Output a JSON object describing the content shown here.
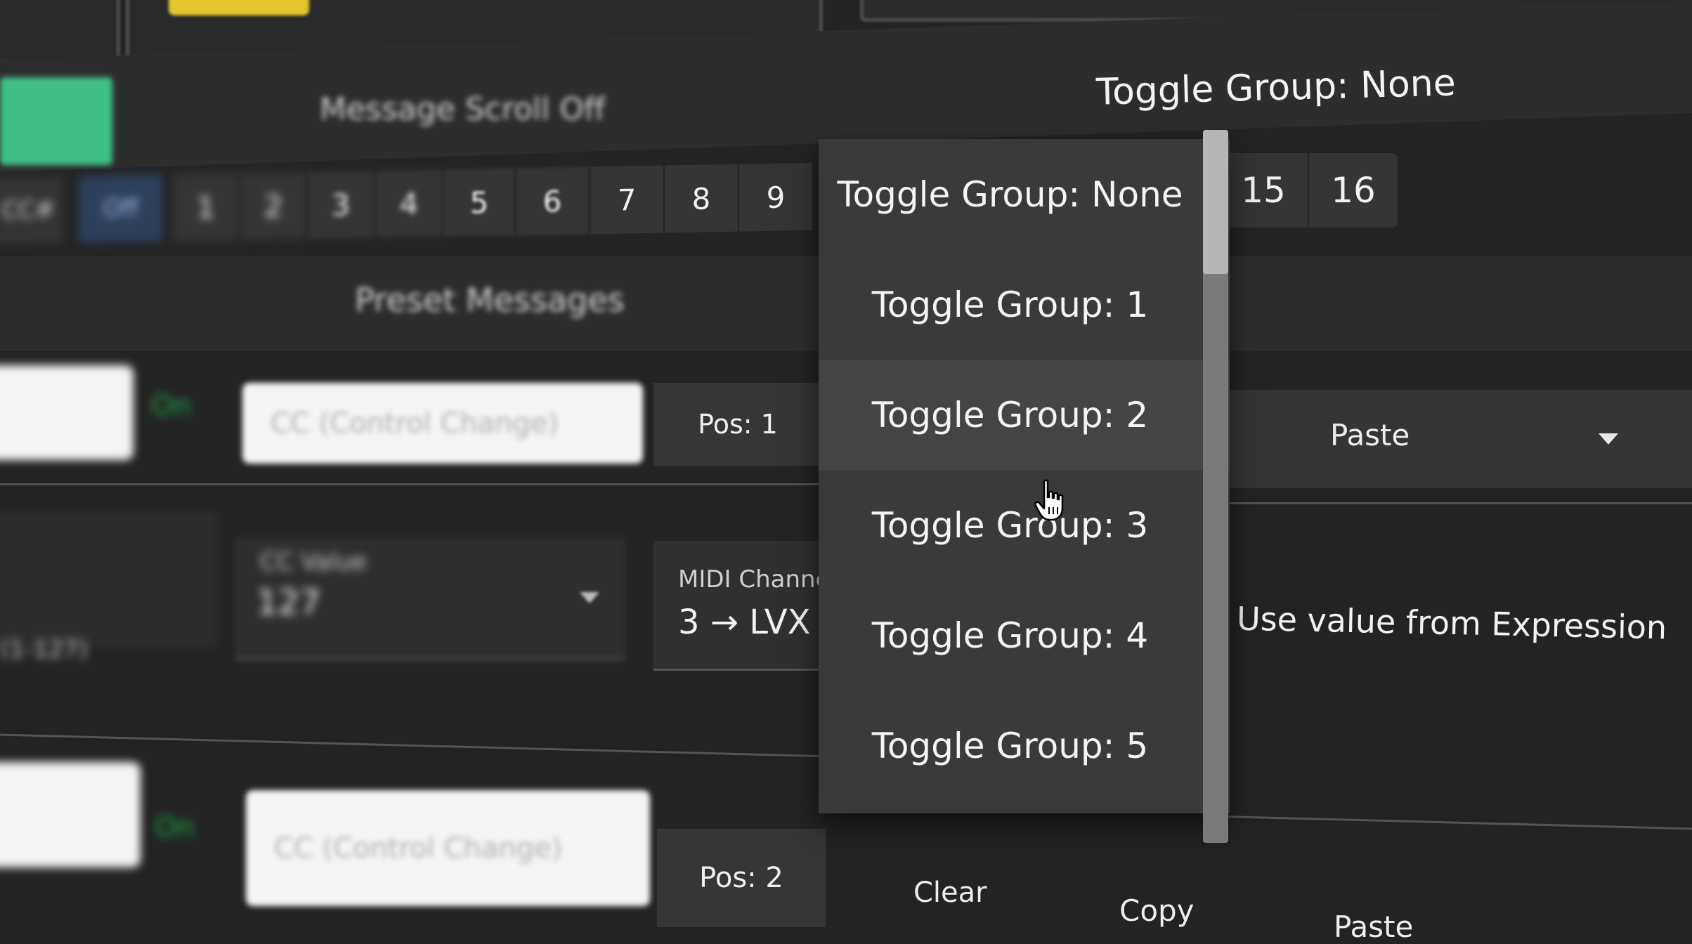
{
  "top": {
    "message_scroll": "Message Scroll Off",
    "toggle_group_current": "Toggle Group: None"
  },
  "buttons_row": {
    "left_labels": [
      "CC#",
      "Off"
    ],
    "numbers_left": [
      "1",
      "2",
      "3",
      "4",
      "5",
      "6",
      "7",
      "8",
      "9"
    ],
    "numbers_right": [
      "15",
      "16"
    ]
  },
  "preset": {
    "title": "Preset Messages",
    "row1": {
      "on_label": "On",
      "type_placeholder": "CC (Control Change)",
      "pos": "Pos: 1",
      "paste": "Paste"
    },
    "row_mid": {
      "cc_value_label": "CC Value",
      "cc_value": "127",
      "left_value": "(1-127)",
      "midi_label": "MIDI Channel",
      "midi_value": "3 → LVX",
      "expression": "Use value from Expression"
    },
    "row2": {
      "on_label": "On",
      "type_placeholder": "CC (Control Change)",
      "pos": "Pos: 2",
      "clear": "Clear",
      "copy": "Copy",
      "paste": "Paste"
    }
  },
  "dropdown": {
    "options": [
      "Toggle Group: None",
      "Toggle Group: 1",
      "Toggle Group: 2",
      "Toggle Group: 3",
      "Toggle Group: 4",
      "Toggle Group: 5"
    ],
    "hovered_index": 2
  },
  "colors": {
    "accent_green": "#3fbf87",
    "yellow": "#e4c52d",
    "off_blue": "#2e3f5a",
    "background": "#232323"
  },
  "icons": {
    "cursor": "hand-pointer-icon",
    "caret": "caret-down-icon"
  }
}
